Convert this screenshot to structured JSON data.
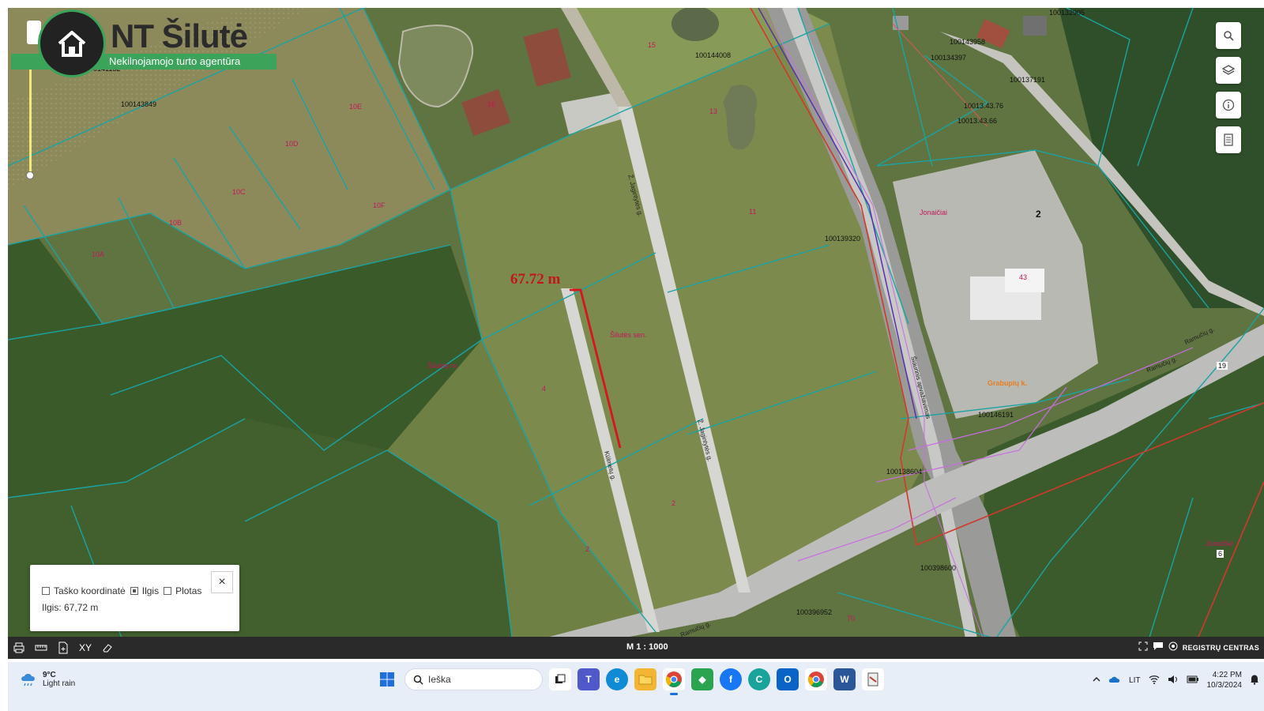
{
  "logo": {
    "brand": "NT Šilutė",
    "tagline": "Nekilnojamojo turto agentūra"
  },
  "map": {
    "measurement_label": "67.72 m",
    "parcel_ids": [
      "100141132",
      "100143849",
      "100144008",
      "100143958",
      "100134397",
      "100137191",
      "10013.43.76",
      "10013.43.66",
      "100132905",
      "100139320",
      "100146191",
      "100138604",
      "100398600",
      "100396952",
      "100416600"
    ],
    "parcel_numbers": [
      "15",
      "16",
      "13",
      "11",
      "10E",
      "10D",
      "10C",
      "10F",
      "10B",
      "10A",
      "4",
      "2",
      "2",
      "43",
      "2",
      "19",
      "6",
      "70"
    ],
    "place_names": [
      "Šilutės m.",
      "Šilutės sen.",
      "Jonaičiai",
      "Grabupių k.",
      "Jonaičiai"
    ],
    "streets": [
      "Ž. Jagintytės g.",
      "Ž. Jagintytės g.",
      "Kūlmetų g.",
      "Šiaurinis apvažiavimas",
      "Ramučių g.",
      "Ramučių g.",
      "Ramučių g."
    ]
  },
  "right_tools": [
    {
      "icon": "search-icon"
    },
    {
      "icon": "layers-icon"
    },
    {
      "icon": "info-icon"
    },
    {
      "icon": "document-icon"
    }
  ],
  "measure_panel": {
    "opt_coordinate": "Taško koordinatė",
    "opt_length": "Ilgis",
    "opt_area": "Plotas",
    "selected": "Ilgis",
    "result": "Ilgis: 67,72 m",
    "close": "×"
  },
  "map_toolbar": {
    "scale": "M 1 : 1000",
    "registry": "REGISTRŲ CENTRAS",
    "xy": "XY"
  },
  "taskbar": {
    "temp": "9°C",
    "weather": "Light rain",
    "search": "Ieška",
    "lang": "LIT",
    "time": "4:22 PM",
    "date": "10/3/2024"
  },
  "colors": {
    "parcel_line": "#1aa3a3",
    "measure_line": "#d8141c",
    "logo_green": "#3ba35a",
    "utility_pink": "#c86de0"
  }
}
